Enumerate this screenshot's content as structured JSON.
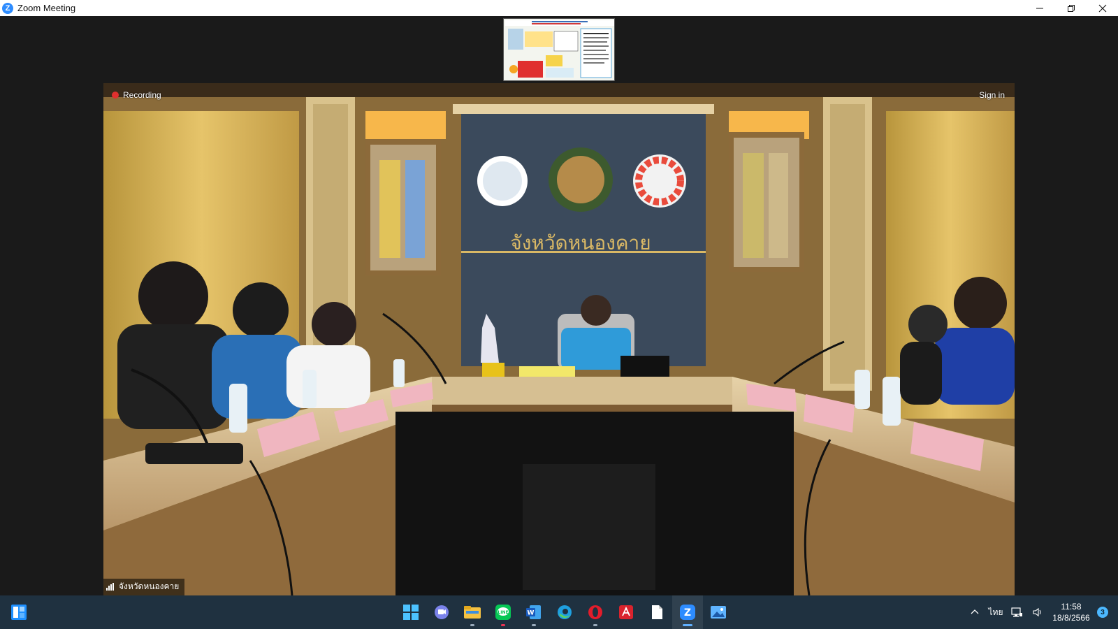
{
  "window": {
    "title": "Zoom Meeting",
    "icon": "zoom-icon",
    "controls": [
      "minimize-icon",
      "restore-icon",
      "close-icon"
    ]
  },
  "meeting": {
    "recording_label": "Recording",
    "sign_in_label": "Sign in",
    "participant_name": "จังหวัดหนองคาย",
    "room_sign_text": "จังหวัดหนองคาย",
    "thumbnail": "shared-content-thumbnail"
  },
  "taskbar": {
    "start_icon": "windows-start-icon",
    "apps": [
      {
        "name": "windows-icon",
        "active": false
      },
      {
        "name": "teams-chat-icon",
        "active": false
      },
      {
        "name": "file-explorer-icon",
        "active": false
      },
      {
        "name": "line-icon",
        "active": false
      },
      {
        "name": "word-icon",
        "active": false
      },
      {
        "name": "edge-icon",
        "active": false
      },
      {
        "name": "opera-icon",
        "active": false
      },
      {
        "name": "acrobat-icon",
        "active": false
      },
      {
        "name": "notepad-icon",
        "active": false
      },
      {
        "name": "zoom-icon",
        "active": true
      },
      {
        "name": "photos-icon",
        "active": false
      }
    ],
    "language": "ไทย",
    "time": "11:58",
    "date": "18/8/2566",
    "notification_count": "3",
    "colors": {
      "bar": "#1f3140",
      "accent": "#60b0ff"
    }
  }
}
